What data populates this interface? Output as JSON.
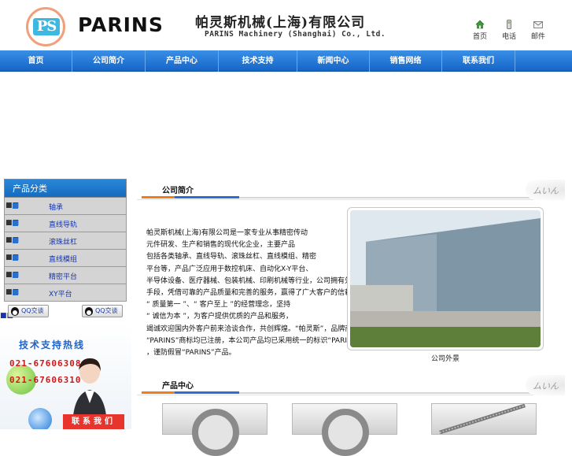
{
  "header": {
    "logo_mark": "PS",
    "logo_text": "PARINS",
    "company_cn": "帕灵斯机械(上海)有限公司",
    "company_en": "PARINS  Machinery (Shanghai) Co., Ltd.",
    "links": [
      {
        "label": "首页",
        "icon": "home-icon"
      },
      {
        "label": "电话",
        "icon": "phone-icon"
      },
      {
        "label": "邮件",
        "icon": "mail-icon"
      }
    ]
  },
  "nav": {
    "items": [
      "首页",
      "公司简介",
      "产品中心",
      "技术支持",
      "新闻中心",
      "销售网络",
      "联系我们"
    ]
  },
  "sidebar": {
    "title": "产品分类",
    "categories": [
      {
        "prefix": "■■",
        "label": "轴承"
      },
      {
        "prefix": "■■",
        "label": "直线导轨"
      },
      {
        "prefix": "■■",
        "label": "滚珠丝杠"
      },
      {
        "prefix": "■■",
        "label": "直线模组"
      },
      {
        "prefix": "■■",
        "label": "精密平台"
      },
      {
        "prefix": "■■",
        "label": "XY平台"
      }
    ],
    "qq_prefix": "■■",
    "qq_buttons": [
      "QQ交谈",
      "QQ交谈"
    ]
  },
  "hotline": {
    "title": "技术支持热线",
    "numbers": [
      "021-67606308",
      "021-67606310"
    ],
    "contact_label": "联系我们"
  },
  "about": {
    "title": "公司简介",
    "lines": [
      "帕灵斯机械(上海)有限公司是一家专业从事精密传动",
      "元件研发、生产和销售的现代化企业，主要产品",
      "包括各类轴承、直线导轨、滚珠丝杠、直线模组、精密",
      "平台等，产品广泛应用于数控机床、自动化X-Y平台、",
      "半导体设备、医疗器械、包装机械、印刷机械等行业，公司拥有先进的生产设备和完善的检测",
      "手段，凭借可靠的产品质量和完善的服务，赢得了广大客户的信赖与支持，公司秉承",
      "“ 质量第一 ”、“ 客户至上 ”的经营理念，坚持",
      "“ 诚信为本 ”，为客户提供优质的产品和服务，",
      "竭诚欢迎国内外客户前来洽谈合作，共创辉煌。“帕灵斯”，品牌商标及",
      "“PARINS”商标均已注册，本公司产品均已采用统一的标识“PARINS”，请 认 准 商标",
      "，谨防假冒“PARINS”产品。"
    ],
    "photo_caption": "公司外景"
  },
  "products": {
    "title": "产品中心"
  },
  "decor_text": "ムいん"
}
